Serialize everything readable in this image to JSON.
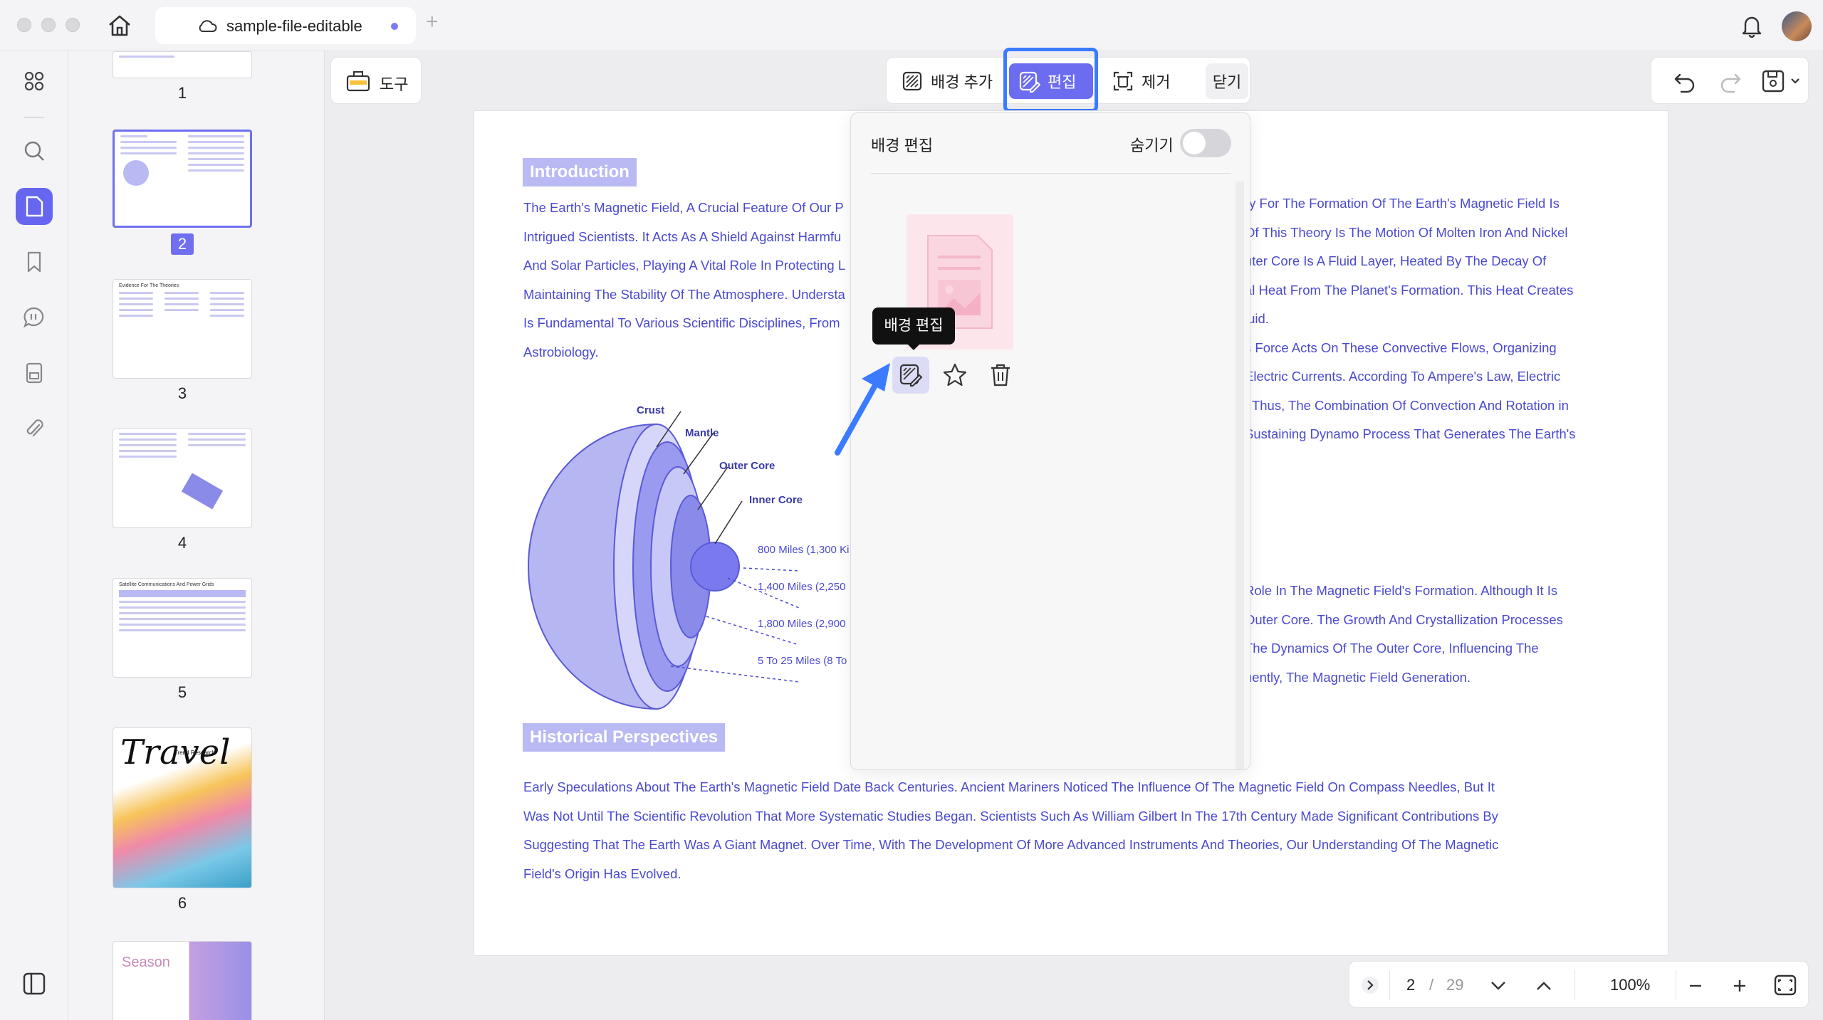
{
  "tab": {
    "title": "sample-file-editable"
  },
  "thumbnails": [
    {
      "number": "1"
    },
    {
      "number": "2"
    },
    {
      "number": "3",
      "title": "Evidence For The Theories"
    },
    {
      "number": "4"
    },
    {
      "number": "5",
      "title": "Satellite Communications And Power Grids"
    },
    {
      "number": "6",
      "title": "Travel",
      "subtitle": "Trend Research"
    },
    {
      "title": "Season"
    }
  ],
  "toolbar": {
    "tools_label": "도구",
    "add_bg_label": "배경 추가",
    "edit_label": "편집",
    "remove_label": "제거",
    "close_label": "닫기"
  },
  "popup": {
    "title": "배경 편집",
    "hide_label": "숨기기",
    "tooltip": "배경 편집"
  },
  "document": {
    "intro_heading": "Introduction",
    "intro_lines": [
      "The Earth's Magnetic Field, A Crucial Feature Of Our P",
      "Intrigued Scientists. It Acts As A Shield Against Harmfu",
      "And Solar Particles, Playing A Vital Role In Protecting L",
      "Maintaining The Stability Of The Atmosphere. Understa",
      "Is Fundamental To Various Scientific Disciplines, From",
      "Astrobiology."
    ],
    "right_lines_1": [
      "ry For The Formation Of The Earth's Magnetic Field Is",
      " Of This Theory Is The Motion Of Molten Iron And Nickel",
      "uter Core Is A Fluid Layer, Heated By The Decay Of",
      "al Heat From The Planet's Formation. This Heat Creates",
      "luid.",
      "s Force Acts On These Convective Flows, Organizing",
      " Electric Currents. According To Ampere's Law, Electric",
      ". Thus, The Combination Of Convection And Rotation in",
      "Sustaining Dynamo Process That Generates The Earth's"
    ],
    "right_lines_2": [
      " Role In The Magnetic Field's Formation. Although It Is",
      "Outer Core. The Growth And Crystallization Processes",
      " The Dynamics Of The Outer Core, Influencing The",
      "uently, The Magnetic Field Generation."
    ],
    "diagram": {
      "crust": "Crust",
      "mantle": "Mantle",
      "outer_core": "Outer Core",
      "inner_core": "Inner Core",
      "dist1": "800 Miles (1,300 Ki",
      "dist2": "1,400 Miles (2,250",
      "dist3": "1,800 Miles (2,900",
      "dist4": "5 To 25 Miles (8 To"
    },
    "hist_heading": "Historical Perspectives",
    "hist_lines": [
      "Early Speculations About The Earth's Magnetic Field Date Back Centuries. Ancient Mariners Noticed The Influence Of The Magnetic Field On Compass Needles, But It",
      "Was Not Until The Scientific Revolution That More Systematic Studies Began. Scientists Such As William Gilbert In The 17th Century Made Significant Contributions By",
      "Suggesting That The Earth Was A Giant Magnet. Over Time, With The Development Of More Advanced Instruments And Theories, Our Understanding Of The Magnetic",
      "Field's Origin Has Evolved."
    ]
  },
  "nav": {
    "current_page": "2",
    "separator": "/",
    "total_pages": "29",
    "zoom": "100%"
  },
  "colors": {
    "accent": "#6c6cf0",
    "highlight": "#3b7bff",
    "doc_text": "#4a4ad0"
  }
}
